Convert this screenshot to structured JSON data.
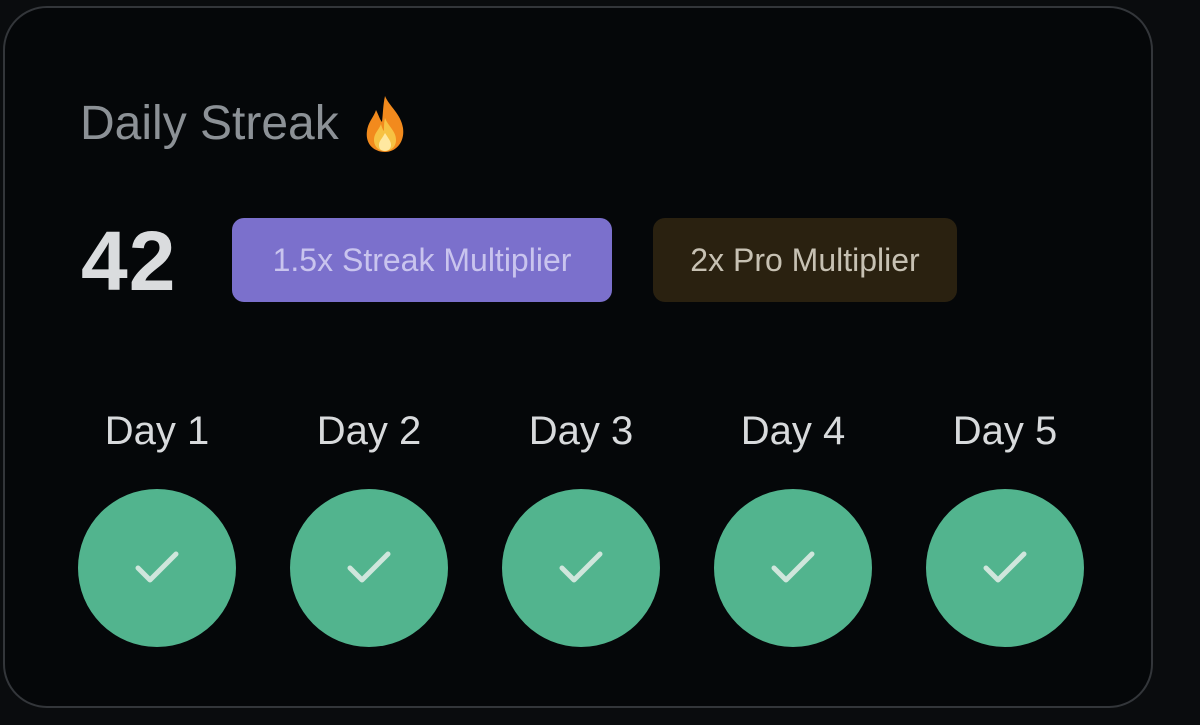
{
  "streak": {
    "title": "Daily Streak",
    "title_icon": "flame-icon",
    "count": "42",
    "badges": [
      {
        "label": "1.5x Streak Multiplier",
        "color": "#7b70cc"
      },
      {
        "label": "2x Pro Multiplier",
        "color": "#2a2110"
      }
    ],
    "days": [
      {
        "label": "Day 1",
        "completed": true,
        "icon": "check-icon"
      },
      {
        "label": "Day 2",
        "completed": true,
        "icon": "check-icon"
      },
      {
        "label": "Day 3",
        "completed": true,
        "icon": "check-icon"
      },
      {
        "label": "Day 4",
        "completed": true,
        "icon": "check-icon"
      },
      {
        "label": "Day 5",
        "completed": true,
        "icon": "check-icon"
      }
    ]
  },
  "colors": {
    "background": "#050709",
    "completed_day": "#52b48e",
    "title_text": "#8c9196"
  }
}
